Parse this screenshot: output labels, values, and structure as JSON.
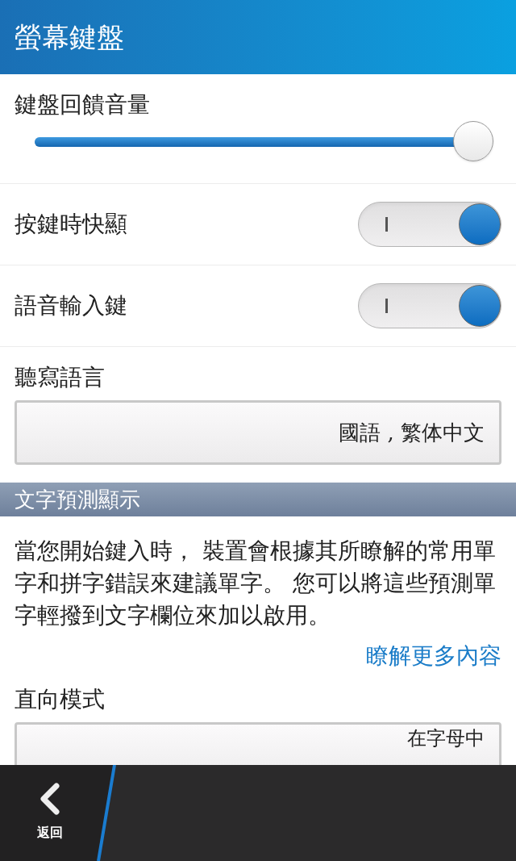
{
  "header": {
    "title": "螢幕鍵盤"
  },
  "volume": {
    "label": "鍵盤回饋音量",
    "level": 0.96
  },
  "toggles": [
    {
      "label": "按鍵時快顯",
      "on": true
    },
    {
      "label": "語音輸入鍵",
      "on": true
    }
  ],
  "dictation": {
    "label": "聽寫語言",
    "value": "國語 , 繁体中文"
  },
  "section": {
    "title": "文字預測顯示"
  },
  "description": "當您開始鍵入時， 裝置會根據其所瞭解的常用單字和拼字錯誤來建議單字。 您可以將這些預測單字輕撥到文字欄位來加以啟用。",
  "link": "瞭解更多內容",
  "portrait": {
    "label": "直向模式",
    "value": "在字母中"
  },
  "action_bar": {
    "back_label": "返回"
  }
}
